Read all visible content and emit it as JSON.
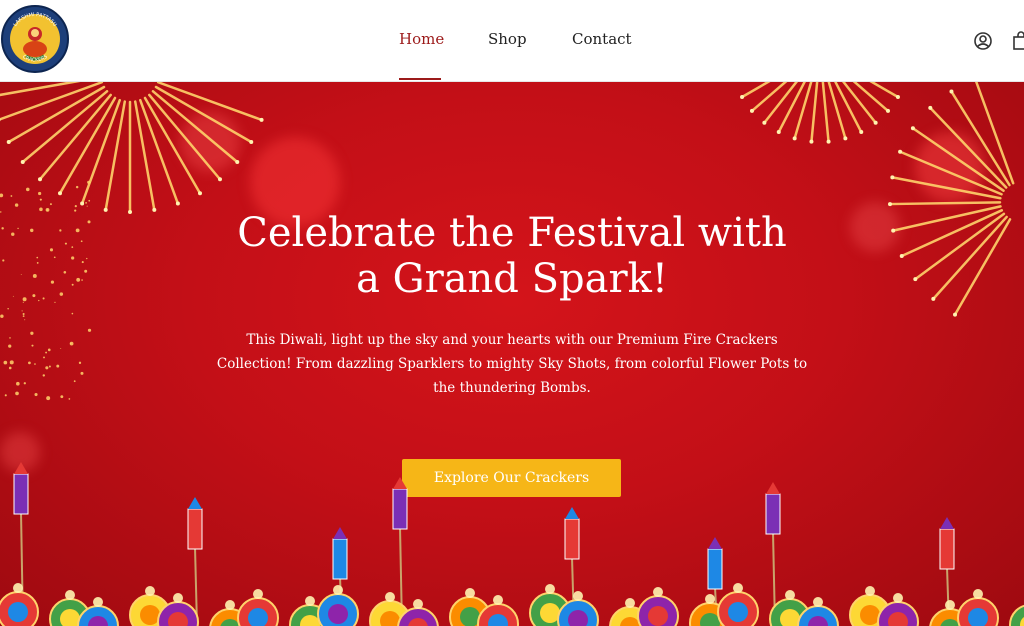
{
  "brand": {
    "logo_text_top": "LAKSHMI PATTASU",
    "logo_text_bottom": "CRACKERS"
  },
  "nav": {
    "items": [
      {
        "label": "Home",
        "active": true
      },
      {
        "label": "Shop",
        "active": false
      },
      {
        "label": "Contact",
        "active": false
      }
    ],
    "account_icon": "user-circle-icon",
    "cart_icon": "shopping-bag-icon"
  },
  "hero": {
    "title_line1": "Celebrate the Festival with",
    "title_line2": "a Grand Spark!",
    "description_line1": "This Diwali, light up the sky and your hearts with our Premium Fire Crackers",
    "description_line2": "Collection! From dazzling Sparklers to mighty Sky Shots, from colorful Flower Pots to",
    "description_line3": "the thundering Bombs.",
    "cta_label": "Explore Our Crackers"
  },
  "colors": {
    "accent": "#9c1a1a",
    "hero_red": "#c8101a",
    "cta": "#f6b617"
  }
}
